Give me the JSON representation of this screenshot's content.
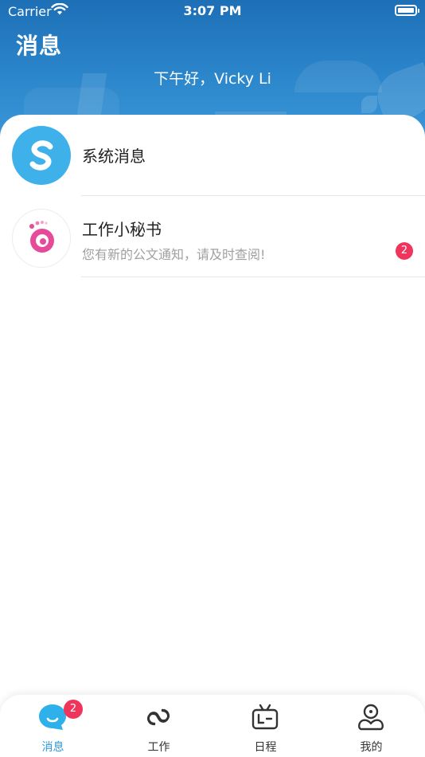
{
  "status_bar": {
    "carrier": "Carrier",
    "time": "3:07 PM",
    "wifi_icon": "wifi-icon",
    "battery_icon": "battery-icon"
  },
  "header": {
    "title": "消息",
    "greeting": "下午好，Vicky Li"
  },
  "messages": [
    {
      "name": "系统消息",
      "preview": "",
      "badge": "",
      "avatar_icon": "system-logo-icon",
      "avatar_color": "#3fb1ea"
    },
    {
      "name": "工作小秘书",
      "preview": "您有新的公文通知，请及时查阅!",
      "badge": "2",
      "avatar_icon": "secretary-mascot-icon",
      "avatar_color": "#ffffff"
    }
  ],
  "tabbar": {
    "tabs": [
      {
        "label": "消息",
        "icon": "chat-bubble-icon",
        "badge": "2",
        "active": true
      },
      {
        "label": "工作",
        "icon": "work-link-icon",
        "badge": "",
        "active": false
      },
      {
        "label": "日程",
        "icon": "calendar-tv-icon",
        "badge": "",
        "active": false
      },
      {
        "label": "我的",
        "icon": "profile-icon",
        "badge": "",
        "active": false
      }
    ]
  },
  "colors": {
    "header_blue": "#1d6fb6",
    "accent_blue": "#2c9be0",
    "badge_red": "#f0355c",
    "avatar_blue": "#3fb1ea",
    "mascot_pink": "#e84a9a"
  }
}
